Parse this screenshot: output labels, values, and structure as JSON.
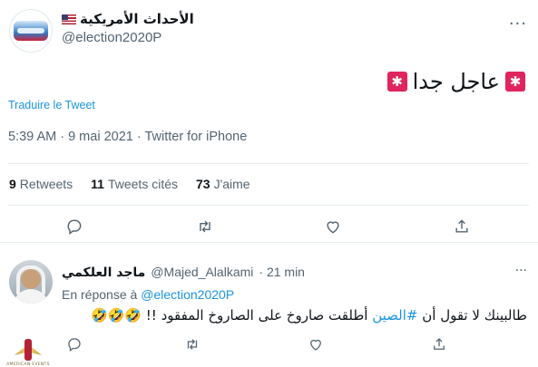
{
  "tweet": {
    "display_name": "الأحداث الأمريكية",
    "handle": "@election2020P",
    "text": "عاجل جدا",
    "siren_emoji": "🚨",
    "translate_label": "Traduire le Tweet",
    "meta": "5:39 AM · 9 mai 2021 · Twitter for iPhone",
    "stats": [
      {
        "num": "9",
        "label": "Retweets"
      },
      {
        "num": "11",
        "label": "Tweets cités"
      },
      {
        "num": "73",
        "label": "J'aime"
      }
    ],
    "more_glyph": "···"
  },
  "reply": {
    "display_name": "ماجد العلكمي",
    "handle": "@Majed_Alalkami",
    "time": "· 21 min",
    "context_prefix": "En réponse à",
    "context_handle": "@election2020P",
    "text_before": "طالبينك لا تقول أن ",
    "hashtag": "#الصين",
    "text_after": " أطلقت صاروخ على الصاروخ المفقود !! ",
    "emojis": "🤣🤣🤣",
    "more_glyph": "···"
  },
  "watermark": {
    "text": "AMERICAN EVENTS"
  },
  "colors": {
    "link": "#1b95e0",
    "secondary_text": "#536471",
    "primary_text": "#0f1419",
    "divider": "#e6ecf0"
  },
  "icons": [
    "reply-icon",
    "retweet-icon",
    "like-icon",
    "share-icon"
  ]
}
